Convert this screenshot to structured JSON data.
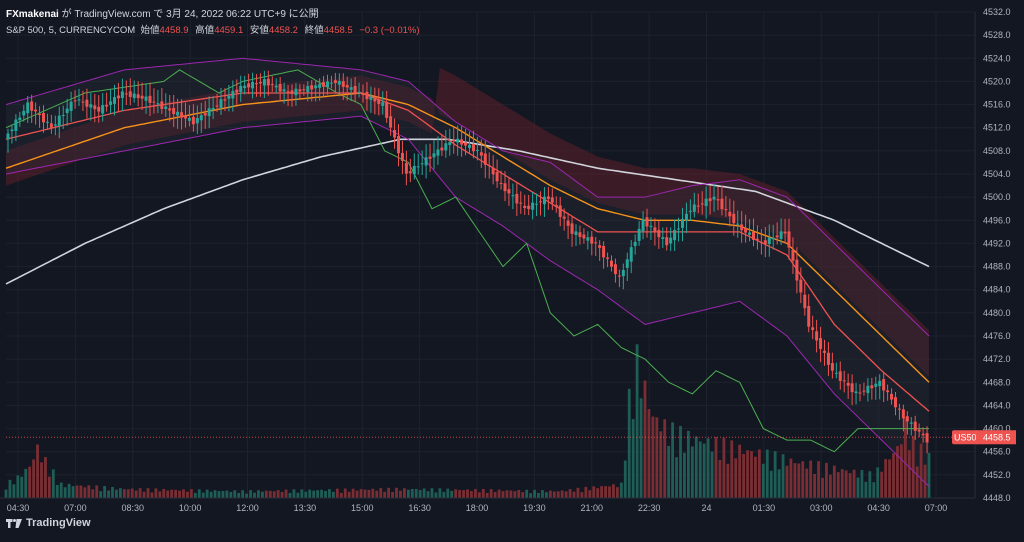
{
  "header": {
    "author": "FXmakenai",
    "publish_text": "が TradingView.com で 3月 24, 2022 06:22 UTC+9 に公開"
  },
  "legend": {
    "symbol": "S&P 500, 5, CURRENCYCOM",
    "open_label": "始値",
    "open_value": "4458.9",
    "high_label": "高値",
    "high_value": "4459.1",
    "low_label": "安値",
    "low_value": "4458.2",
    "close_label": "終値",
    "close_value": "4458.5",
    "change": "−0.3 (−0.01%)"
  },
  "footer": {
    "brand": "TradingView"
  },
  "colors": {
    "background": "#131722",
    "up": "#26a69a",
    "down": "#ef5350",
    "ema_fast": "#ef5350",
    "ema_mid": "#f7931a",
    "ma_long": "#d1d4dc",
    "bollinger": "#9c27b0",
    "chikou": "#4caf50",
    "ema_blue": "#2962ff",
    "cloud_bear": "#5d1f28",
    "cloud_bull": "#1f4d33",
    "price_label": "#ef5350"
  },
  "chart_data": {
    "type": "candlestick",
    "symbol": "US500",
    "last_price": 4458.5,
    "price_label": "US500",
    "price_label_value": "4458.5",
    "y_range": [
      4448,
      4532
    ],
    "y_ticks": [
      "4532.0",
      "4528.0",
      "4524.0",
      "4520.0",
      "4516.0",
      "4512.0",
      "4508.0",
      "4504.0",
      "4500.0",
      "4496.0",
      "4492.0",
      "4488.0",
      "4484.0",
      "4480.0",
      "4476.0",
      "4472.0",
      "4468.0",
      "4464.0",
      "4460.0",
      "4456.0",
      "4452.0",
      "4448.0"
    ],
    "x_ticks": [
      "04:30",
      "07:00",
      "08:30",
      "10:00",
      "12:00",
      "13:30",
      "15:00",
      "16:30",
      "18:00",
      "19:30",
      "21:00",
      "22:30",
      "24",
      "01:30",
      "03:00",
      "04:30",
      "07:00"
    ],
    "price_path": [
      [
        0,
        4510
      ],
      [
        6,
        4516
      ],
      [
        12,
        4512
      ],
      [
        18,
        4517
      ],
      [
        24,
        4515
      ],
      [
        30,
        4518
      ],
      [
        36,
        4517
      ],
      [
        42,
        4515
      ],
      [
        48,
        4513
      ],
      [
        54,
        4516
      ],
      [
        60,
        4519
      ],
      [
        66,
        4520
      ],
      [
        72,
        4518
      ],
      [
        78,
        4519
      ],
      [
        84,
        4520
      ],
      [
        90,
        4518
      ],
      [
        96,
        4516
      ],
      [
        102,
        4504
      ],
      [
        108,
        4507
      ],
      [
        114,
        4510
      ],
      [
        120,
        4508
      ],
      [
        126,
        4502
      ],
      [
        132,
        4498
      ],
      [
        138,
        4500
      ],
      [
        144,
        4494
      ],
      [
        150,
        4492
      ],
      [
        156,
        4486
      ],
      [
        162,
        4496
      ],
      [
        168,
        4492
      ],
      [
        174,
        4498
      ],
      [
        180,
        4500
      ],
      [
        186,
        4495
      ],
      [
        192,
        4492
      ],
      [
        198,
        4494
      ],
      [
        204,
        4478
      ],
      [
        210,
        4470
      ],
      [
        216,
        4466
      ],
      [
        222,
        4468
      ],
      [
        228,
        4462
      ],
      [
        234,
        4458
      ]
    ],
    "volume_profile": [
      [
        0,
        6
      ],
      [
        3,
        9
      ],
      [
        6,
        14
      ],
      [
        8,
        22
      ],
      [
        10,
        16
      ],
      [
        14,
        6
      ],
      [
        30,
        4
      ],
      [
        60,
        3
      ],
      [
        100,
        4
      ],
      [
        140,
        3
      ],
      [
        156,
        6
      ],
      [
        158,
        42
      ],
      [
        160,
        60
      ],
      [
        162,
        48
      ],
      [
        164,
        36
      ],
      [
        168,
        30
      ],
      [
        172,
        27
      ],
      [
        180,
        24
      ],
      [
        190,
        20
      ],
      [
        200,
        16
      ],
      [
        210,
        13
      ],
      [
        220,
        10
      ],
      [
        226,
        22
      ],
      [
        228,
        32
      ],
      [
        230,
        24
      ],
      [
        234,
        18
      ]
    ],
    "ema_fast_path": [
      [
        0,
        4510
      ],
      [
        30,
        4515
      ],
      [
        60,
        4518
      ],
      [
        90,
        4518
      ],
      [
        102,
        4515
      ],
      [
        114,
        4509
      ],
      [
        126,
        4504
      ],
      [
        138,
        4499
      ],
      [
        150,
        4494
      ],
      [
        162,
        4494
      ],
      [
        174,
        4494
      ],
      [
        186,
        4494
      ],
      [
        198,
        4490
      ],
      [
        210,
        4478
      ],
      [
        222,
        4470
      ],
      [
        234,
        4463
      ]
    ],
    "ema_mid_path": [
      [
        0,
        4505
      ],
      [
        30,
        4512
      ],
      [
        60,
        4516
      ],
      [
        90,
        4518
      ],
      [
        102,
        4516
      ],
      [
        114,
        4512
      ],
      [
        126,
        4507
      ],
      [
        138,
        4502
      ],
      [
        150,
        4498
      ],
      [
        162,
        4496
      ],
      [
        174,
        4496
      ],
      [
        186,
        4495
      ],
      [
        198,
        4492
      ],
      [
        210,
        4484
      ],
      [
        222,
        4476
      ],
      [
        234,
        4468
      ]
    ],
    "ma_long_path": [
      [
        0,
        4485
      ],
      [
        20,
        4492
      ],
      [
        40,
        4498
      ],
      [
        60,
        4503
      ],
      [
        80,
        4507
      ],
      [
        100,
        4510
      ],
      [
        112,
        4510
      ],
      [
        130,
        4508
      ],
      [
        150,
        4505
      ],
      [
        170,
        4503
      ],
      [
        190,
        4501
      ],
      [
        210,
        4496
      ],
      [
        234,
        4488
      ]
    ],
    "chikou_path": [
      [
        0,
        4512
      ],
      [
        20,
        4518
      ],
      [
        40,
        4520
      ],
      [
        44,
        4522
      ],
      [
        54,
        4518
      ],
      [
        60,
        4520
      ],
      [
        74,
        4522
      ],
      [
        84,
        4518
      ],
      [
        90,
        4516
      ],
      [
        96,
        4508
      ],
      [
        102,
        4506
      ],
      [
        108,
        4498
      ],
      [
        114,
        4500
      ],
      [
        120,
        4494
      ],
      [
        126,
        4488
      ],
      [
        132,
        4492
      ],
      [
        138,
        4480
      ],
      [
        144,
        4476
      ],
      [
        150,
        4478
      ],
      [
        156,
        4474
      ],
      [
        162,
        4472
      ],
      [
        168,
        4468
      ],
      [
        174,
        4466
      ],
      [
        180,
        4470
      ],
      [
        186,
        4468
      ],
      [
        192,
        4460
      ],
      [
        198,
        4458
      ],
      [
        204,
        4458
      ],
      [
        210,
        4456
      ],
      [
        216,
        4460
      ],
      [
        222,
        4460
      ]
    ],
    "bb_upper_path": [
      [
        0,
        4516
      ],
      [
        30,
        4522
      ],
      [
        60,
        4524
      ],
      [
        90,
        4522
      ],
      [
        102,
        4520
      ],
      [
        114,
        4513
      ],
      [
        126,
        4508
      ],
      [
        138,
        4506
      ],
      [
        150,
        4500
      ],
      [
        162,
        4500
      ],
      [
        174,
        4502
      ],
      [
        186,
        4503
      ],
      [
        198,
        4500
      ],
      [
        210,
        4492
      ],
      [
        222,
        4484
      ],
      [
        234,
        4476
      ]
    ],
    "bb_lower_path": [
      [
        0,
        4504
      ],
      [
        30,
        4508
      ],
      [
        60,
        4512
      ],
      [
        90,
        4514
      ],
      [
        102,
        4510
      ],
      [
        114,
        4500
      ],
      [
        126,
        4495
      ],
      [
        138,
        4489
      ],
      [
        150,
        4484
      ],
      [
        162,
        4478
      ],
      [
        174,
        4480
      ],
      [
        186,
        4482
      ],
      [
        198,
        4476
      ],
      [
        210,
        4466
      ],
      [
        222,
        4458
      ],
      [
        234,
        4450
      ]
    ]
  }
}
